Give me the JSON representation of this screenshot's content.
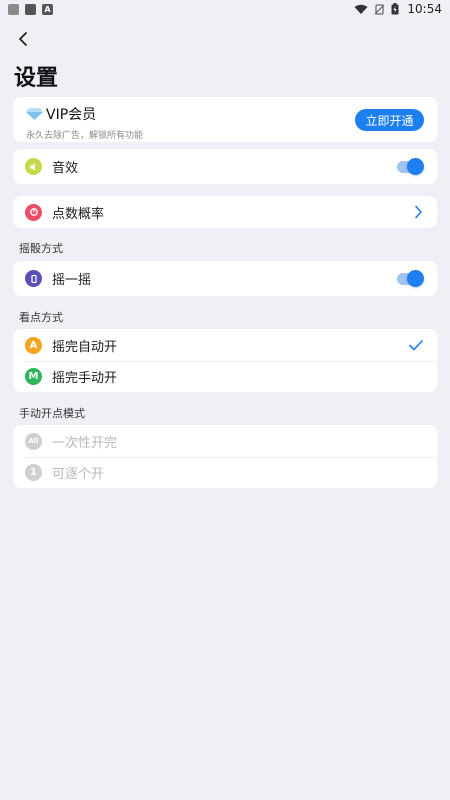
{
  "status_bar": {
    "time": "10:54"
  },
  "page": {
    "title": "设置"
  },
  "vip": {
    "title": "VIP会员",
    "subtitle": "永久去除广告，解锁所有功能",
    "button": "立即开通"
  },
  "sound": {
    "label": "音效",
    "enabled": true
  },
  "probability": {
    "label": "点数概率"
  },
  "shake_section": {
    "header": "摇骰方式",
    "item": {
      "label": "摇一摇",
      "enabled": true
    }
  },
  "view_section": {
    "header": "看点方式",
    "items": [
      {
        "label": "摇完自动开",
        "icon_letter": "A",
        "selected": true
      },
      {
        "label": "摇完手动开",
        "icon_letter": "M",
        "selected": false
      }
    ]
  },
  "manual_section": {
    "header": "手动开点模式",
    "items": [
      {
        "label": "一次性开完",
        "icon_letter": "All"
      },
      {
        "label": "可逐个开",
        "icon_letter": "1"
      }
    ]
  },
  "colors": {
    "accent": "#1e7ff0",
    "background": "#eff0f5",
    "sound_icon": "#c6d94a",
    "probability_icon": "#ea4e68",
    "shake_icon": "#5b4fb8",
    "auto_icon": "#f3a51f",
    "manual_icon": "#2fb55a",
    "disabled_icon": "#cfcfcf"
  },
  "icons": {
    "back": "chevron-left-icon",
    "vip": "diamond-icon",
    "sound": "speaker-icon",
    "probability": "pie-icon",
    "shake": "phone-shake-icon",
    "chevron": "chevron-right-icon",
    "check": "checkmark-icon"
  }
}
